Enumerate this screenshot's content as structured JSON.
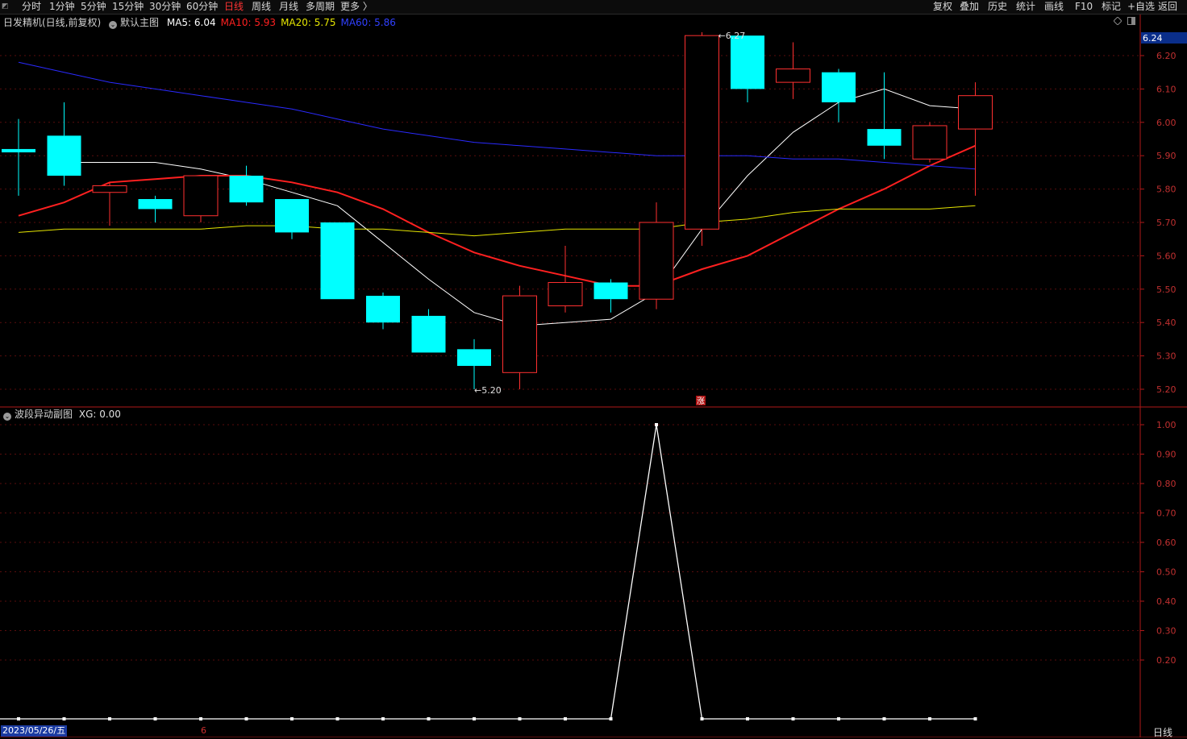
{
  "toolbar": {
    "periods": [
      "分时",
      "1分钟",
      "5分钟",
      "15分钟",
      "30分钟",
      "60分钟",
      "日线",
      "周线",
      "月线",
      "多周期",
      "更多 〉"
    ],
    "active_period": "日线",
    "right_buttons": [
      "复权",
      "叠加",
      "历史",
      "统计",
      "画线",
      "F10",
      "标记",
      "+自选",
      "返回"
    ]
  },
  "main_panel": {
    "stock_label": "日发精机(日线,前复权)",
    "indicator_name": "默认主图",
    "ma_labels": [
      {
        "text": "MA5: 6.04",
        "color": "#ffffff"
      },
      {
        "text": "MA10: 5.93",
        "color": "#ff2020"
      },
      {
        "text": "MA20: 5.75",
        "color": "#e6e600"
      },
      {
        "text": "MA60: 5.86",
        "color": "#3040ff"
      }
    ],
    "price_tag": "6.24",
    "high_label": "6.27",
    "low_label": "5.20",
    "marker": "涨"
  },
  "sub_panel": {
    "title": "波段异动副图",
    "value_label": "XG: 0.00"
  },
  "footer": {
    "date": "2023/05/26/五",
    "month_mark": "6",
    "period_tab": "日线"
  },
  "colors": {
    "up": "#ff3030",
    "down": "#00ffff",
    "ma5": "#ffffff",
    "ma10": "#ff2020",
    "ma20": "#e6e600",
    "ma60": "#2a2aff",
    "grid": "#5a0d0d",
    "axis": "#b01818"
  },
  "chart_data": [
    {
      "type": "candlestick",
      "title": "日发精机(日线,前复权)",
      "y_ticks": [
        6.2,
        6.1,
        6.0,
        5.9,
        5.8,
        5.7,
        5.6,
        5.5,
        5.4,
        5.3,
        5.2
      ],
      "ylim": [
        5.18,
        6.27
      ],
      "candles": [
        {
          "o": 5.92,
          "c": 5.91,
          "h": 6.01,
          "l": 5.78
        },
        {
          "o": 5.96,
          "c": 5.84,
          "h": 6.06,
          "l": 5.81
        },
        {
          "o": 5.79,
          "c": 5.81,
          "h": 5.82,
          "l": 5.69
        },
        {
          "o": 5.77,
          "c": 5.74,
          "h": 5.78,
          "l": 5.7
        },
        {
          "o": 5.72,
          "c": 5.84,
          "h": 5.84,
          "l": 5.7
        },
        {
          "o": 5.84,
          "c": 5.76,
          "h": 5.87,
          "l": 5.75
        },
        {
          "o": 5.77,
          "c": 5.67,
          "h": 5.77,
          "l": 5.65
        },
        {
          "o": 5.7,
          "c": 5.47,
          "h": 5.7,
          "l": 5.47
        },
        {
          "o": 5.48,
          "c": 5.4,
          "h": 5.49,
          "l": 5.38
        },
        {
          "o": 5.42,
          "c": 5.31,
          "h": 5.44,
          "l": 5.31
        },
        {
          "o": 5.32,
          "c": 5.27,
          "h": 5.35,
          "l": 5.2
        },
        {
          "o": 5.25,
          "c": 5.48,
          "h": 5.51,
          "l": 5.2
        },
        {
          "o": 5.45,
          "c": 5.52,
          "h": 5.63,
          "l": 5.43
        },
        {
          "o": 5.52,
          "c": 5.47,
          "h": 5.53,
          "l": 5.43
        },
        {
          "o": 5.47,
          "c": 5.7,
          "h": 5.76,
          "l": 5.44
        },
        {
          "o": 5.68,
          "c": 6.26,
          "h": 6.27,
          "l": 5.63
        },
        {
          "o": 6.26,
          "c": 6.1,
          "h": 6.26,
          "l": 6.06
        },
        {
          "o": 6.12,
          "c": 6.16,
          "h": 6.24,
          "l": 6.07
        },
        {
          "o": 6.15,
          "c": 6.06,
          "h": 6.16,
          "l": 6.0
        },
        {
          "o": 5.98,
          "c": 5.93,
          "h": 6.15,
          "l": 5.89
        },
        {
          "o": 5.89,
          "c": 5.99,
          "h": 6.0,
          "l": 5.88
        },
        {
          "o": 5.98,
          "c": 6.08,
          "h": 6.12,
          "l": 5.78
        }
      ],
      "series": [
        {
          "name": "MA5",
          "values": [
            5.88,
            5.88,
            5.88,
            5.86,
            5.83,
            5.79,
            5.75,
            5.64,
            5.53,
            5.43,
            5.39,
            5.4,
            5.41,
            5.49,
            5.68,
            5.84,
            5.97,
            6.06,
            6.1,
            6.05,
            6.04
          ]
        },
        {
          "name": "MA10",
          "values": [
            5.72,
            5.76,
            5.82,
            5.83,
            5.84,
            5.84,
            5.82,
            5.79,
            5.74,
            5.67,
            5.61,
            5.57,
            5.54,
            5.51,
            5.51,
            5.56,
            5.6,
            5.67,
            5.74,
            5.8,
            5.87,
            5.93
          ]
        },
        {
          "name": "MA20",
          "values": [
            5.67,
            5.68,
            5.68,
            5.68,
            5.68,
            5.69,
            5.69,
            5.68,
            5.68,
            5.67,
            5.66,
            5.67,
            5.68,
            5.68,
            5.68,
            5.7,
            5.71,
            5.73,
            5.74,
            5.74,
            5.74,
            5.75
          ]
        },
        {
          "name": "MA60",
          "values": [
            6.18,
            6.15,
            6.12,
            6.1,
            6.08,
            6.06,
            6.04,
            6.01,
            5.98,
            5.96,
            5.94,
            5.93,
            5.92,
            5.91,
            5.9,
            5.9,
            5.9,
            5.89,
            5.89,
            5.88,
            5.87,
            5.86
          ]
        }
      ]
    },
    {
      "type": "line",
      "title": "波段异动副图",
      "y_ticks": [
        1.0,
        0.9,
        0.8,
        0.7,
        0.6,
        0.5,
        0.4,
        0.3,
        0.2
      ],
      "ylim": [
        0,
        1.05
      ],
      "series": [
        {
          "name": "XG",
          "values": [
            0,
            0,
            0,
            0,
            0,
            0,
            0,
            0,
            0,
            0,
            0,
            0,
            0,
            0,
            1,
            0,
            0,
            0,
            0,
            0,
            0,
            0
          ]
        }
      ]
    }
  ]
}
